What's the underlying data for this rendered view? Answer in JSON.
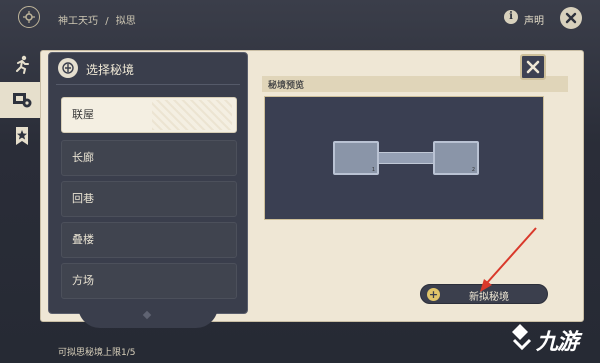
{
  "breadcrumb": {
    "part1": "神工天巧",
    "sep": "/",
    "part2": "拟思"
  },
  "header": {
    "declare_label": "声明",
    "info_glyph": "i"
  },
  "select_panel": {
    "title": "选择秘境",
    "options": [
      "联屋",
      "长廊",
      "回巷",
      "叠楼",
      "方场"
    ],
    "selected_index": 0
  },
  "preview": {
    "title": "秘境预览",
    "room_left_num": "1",
    "room_right_num": "2"
  },
  "new_button": {
    "label": "新拟秘境",
    "plus": "+"
  },
  "footer": {
    "limit_text": "可拟思秘境上限1/5"
  },
  "watermark": {
    "text": "九游"
  },
  "colors": {
    "accent_red": "#d9392b",
    "gold": "#e0c56a",
    "panel_dark": "#3a3e4c",
    "parchment": "#efe7d5"
  },
  "icons": [
    "emblem-icon",
    "info-icon",
    "close-icon",
    "run-icon",
    "domain-icon",
    "star-bookmark-icon",
    "select-domain-icon",
    "plus-icon"
  ]
}
